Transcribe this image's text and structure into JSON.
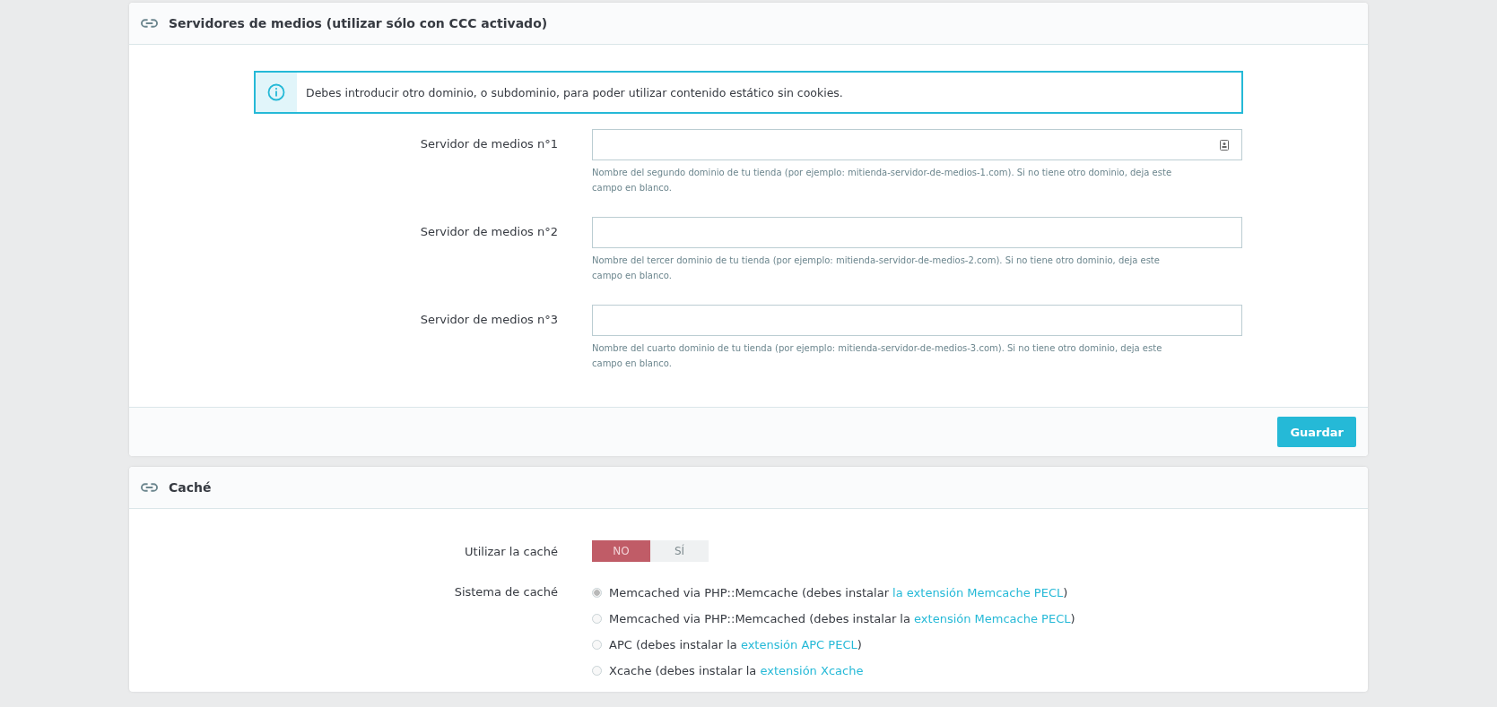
{
  "panels": [
    {
      "title": "Servidores de medios (utilizar sólo con CCC activado)",
      "alert": "Debes introducir otro dominio, o subdominio, para poder utilizar contenido estático sin cookies.",
      "fields": [
        {
          "label": "Servidor de medios n°1",
          "help": "Nombre del segundo dominio de tu tienda (por ejemplo: mitienda-servidor-de-medios-1.com). Si no tiene otro dominio, deja este campo en blanco.",
          "has_icon": true
        },
        {
          "label": "Servidor de medios n°2",
          "help": "Nombre del tercer dominio de tu tienda (por ejemplo: mitienda-servidor-de-medios-2.com). Si no tiene otro dominio, deja este campo en blanco.",
          "has_icon": false
        },
        {
          "label": "Servidor de medios n°3",
          "help": "Nombre del cuarto dominio de tu tienda (por ejemplo: mitienda-servidor-de-medios-3.com). Si no tiene otro dominio, deja este campo en blanco.",
          "has_icon": false
        }
      ],
      "save_button": "Guardar"
    },
    {
      "title": "Caché",
      "toggle": {
        "label": "Utilizar la caché",
        "options": [
          {
            "label": "NO",
            "selected": true
          },
          {
            "label": "SÍ",
            "selected": false
          }
        ]
      },
      "radio_group": {
        "label": "Sistema de caché",
        "options": [
          {
            "text": "Memcached via PHP::Memcache (debes instalar ",
            "link": "la extensión Memcache PECL",
            "after": ")",
            "selected": true
          },
          {
            "text": "Memcached via PHP::Memcached (debes instalar la ",
            "link": "extensión Memcache PECL",
            "after": ")",
            "selected": false
          },
          {
            "text": "APC (debes instalar la ",
            "link": "extensión APC PECL",
            "after": ")",
            "selected": false
          },
          {
            "text": "Xcache (debes instalar la ",
            "link": "extensión Xcache",
            "selected": false
          }
        ]
      }
    }
  ]
}
